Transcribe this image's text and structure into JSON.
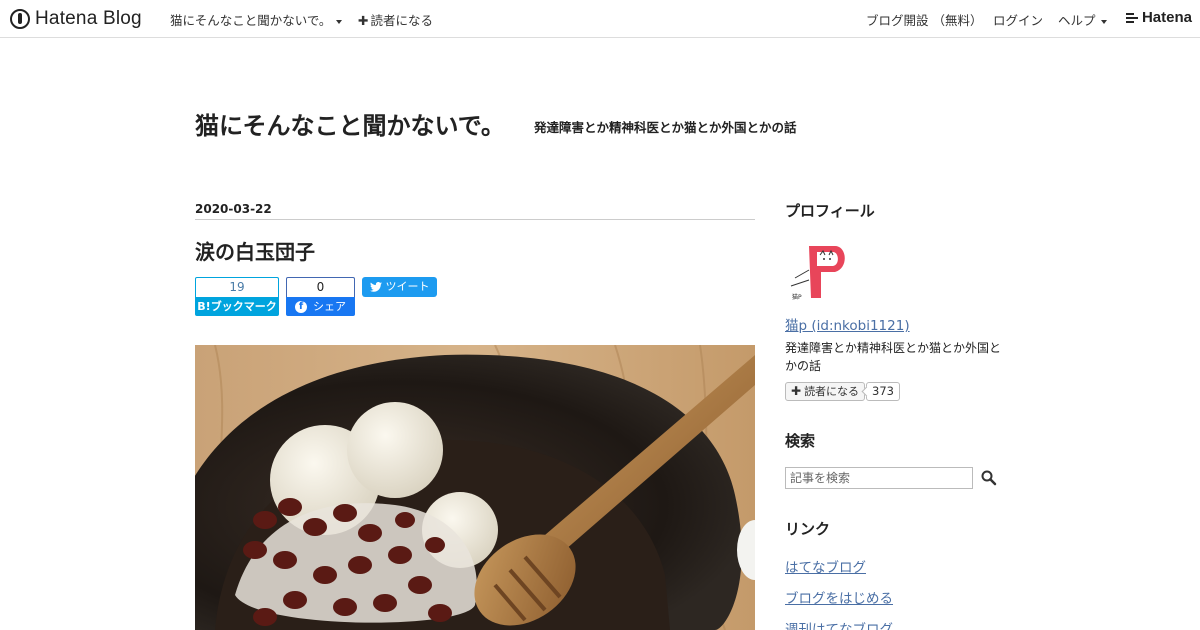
{
  "topbar": {
    "logo_text": "Hatena Blog",
    "blog_menu": "猫にそんなこと聞かないで。",
    "subscribe": "読者になる",
    "open_blog": "ブログ開設 （無料）",
    "login": "ログイン",
    "help": "ヘルプ",
    "hatena_logo": "Hatena"
  },
  "header": {
    "title": "猫にそんなこと聞かないで。",
    "description": "発達障害とか精神科医とか猫とか外国とかの話"
  },
  "entry": {
    "date": "2020-03-22",
    "title": "涙の白玉団子",
    "bookmark": {
      "count": "19",
      "label": "ブックマーク",
      "mark": "B!"
    },
    "facebook": {
      "count": "0",
      "label": "シェア",
      "mark": "f"
    },
    "tweet_label": "ツイート"
  },
  "sidebar": {
    "profile": {
      "heading": "プロフィール",
      "user_link": "猫p (id:nkobi1121)",
      "description": "発達障害とか精神科医とか猫とか外国とかの話",
      "subscribe_label": "読者になる",
      "subscriber_count": "373",
      "avatar_letter": "P",
      "avatar_caption": "猫P"
    },
    "search": {
      "heading": "検索",
      "placeholder": "記事を検索"
    },
    "links": {
      "heading": "リンク",
      "items": [
        "はてなブログ",
        "ブログをはじめる",
        "週刊はてなブログ"
      ]
    }
  },
  "colors": {
    "bookmark_blue": "#00a4de",
    "facebook_blue": "#1877f2",
    "twitter_blue": "#1d9bf0",
    "link_blue": "#4a6fa5",
    "avatar_red": "#e8455a"
  }
}
